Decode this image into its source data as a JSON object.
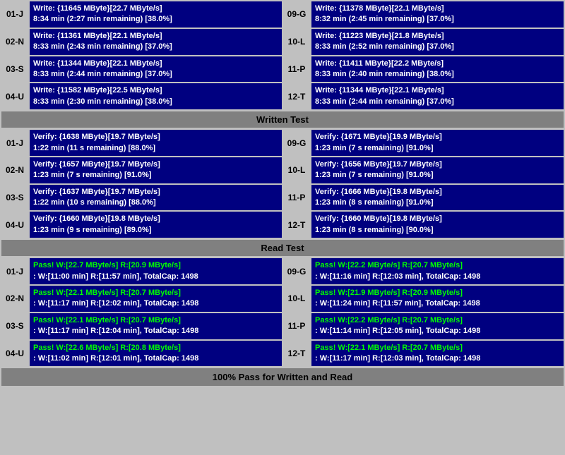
{
  "sections": {
    "write": {
      "rows": [
        {
          "left": {
            "id": "01-J",
            "line1": "Write: {11645 MByte}[22.7 MByte/s]",
            "line2": "8:34 min (2:27 min remaining)  [38.0%]"
          },
          "right": {
            "id": "09-G",
            "line1": "Write: {11378 MByte}[22.1 MByte/s]",
            "line2": "8:32 min (2:45 min remaining)  [37.0%]"
          }
        },
        {
          "left": {
            "id": "02-N",
            "line1": "Write: {11361 MByte}[22.1 MByte/s]",
            "line2": "8:33 min (2:43 min remaining)  [37.0%]"
          },
          "right": {
            "id": "10-L",
            "line1": "Write: {11223 MByte}[21.8 MByte/s]",
            "line2": "8:33 min (2:52 min remaining)  [37.0%]"
          }
        },
        {
          "left": {
            "id": "03-S",
            "line1": "Write: {11344 MByte}[22.1 MByte/s]",
            "line2": "8:33 min (2:44 min remaining)  [37.0%]"
          },
          "right": {
            "id": "11-P",
            "line1": "Write: {11411 MByte}[22.2 MByte/s]",
            "line2": "8:33 min (2:40 min remaining)  [38.0%]"
          }
        },
        {
          "left": {
            "id": "04-U",
            "line1": "Write: {11582 MByte}[22.5 MByte/s]",
            "line2": "8:33 min (2:30 min remaining)  [38.0%]"
          },
          "right": {
            "id": "12-T",
            "line1": "Write: {11344 MByte}[22.1 MByte/s]",
            "line2": "8:33 min (2:44 min remaining)  [37.0%]"
          }
        }
      ],
      "header": "Written Test"
    },
    "verify": {
      "rows": [
        {
          "left": {
            "id": "01-J",
            "line1": "Verify: {1638 MByte}[19.7 MByte/s]",
            "line2": "1:22 min (11 s remaining)   [88.0%]"
          },
          "right": {
            "id": "09-G",
            "line1": "Verify: {1671 MByte}[19.9 MByte/s]",
            "line2": "1:23 min (7 s remaining)   [91.0%]"
          }
        },
        {
          "left": {
            "id": "02-N",
            "line1": "Verify: {1657 MByte}[19.7 MByte/s]",
            "line2": "1:23 min (7 s remaining)   [91.0%]"
          },
          "right": {
            "id": "10-L",
            "line1": "Verify: {1656 MByte}[19.7 MByte/s]",
            "line2": "1:23 min (7 s remaining)   [91.0%]"
          }
        },
        {
          "left": {
            "id": "03-S",
            "line1": "Verify: {1637 MByte}[19.7 MByte/s]",
            "line2": "1:22 min (10 s remaining)   [88.0%]"
          },
          "right": {
            "id": "11-P",
            "line1": "Verify: {1666 MByte}[19.8 MByte/s]",
            "line2": "1:23 min (8 s remaining)   [91.0%]"
          }
        },
        {
          "left": {
            "id": "04-U",
            "line1": "Verify: {1660 MByte}[19.8 MByte/s]",
            "line2": "1:23 min (9 s remaining)   [89.0%]"
          },
          "right": {
            "id": "12-T",
            "line1": "Verify: {1660 MByte}[19.8 MByte/s]",
            "line2": "1:23 min (8 s remaining)   [90.0%]"
          }
        }
      ],
      "header": "Read Test"
    },
    "pass": {
      "rows": [
        {
          "left": {
            "id": "01-J",
            "line1": "Pass! W:[22.7 MByte/s] R:[20.9 MByte/s]",
            "line2": "W:[11:00 min] R:[11:57 min], TotalCap: 1498"
          },
          "right": {
            "id": "09-G",
            "line1": "Pass! W:[22.2 MByte/s] R:[20.7 MByte/s]",
            "line2": "W:[11:16 min] R:[12:03 min], TotalCap: 1498"
          }
        },
        {
          "left": {
            "id": "02-N",
            "line1": "Pass! W:[22.1 MByte/s] R:[20.7 MByte/s]",
            "line2": "W:[11:17 min] R:[12:02 min], TotalCap: 1498"
          },
          "right": {
            "id": "10-L",
            "line1": "Pass! W:[21.9 MByte/s] R:[20.9 MByte/s]",
            "line2": "W:[11:24 min] R:[11:57 min], TotalCap: 1498"
          }
        },
        {
          "left": {
            "id": "03-S",
            "line1": "Pass! W:[22.1 MByte/s] R:[20.7 MByte/s]",
            "line2": "W:[11:17 min] R:[12:04 min], TotalCap: 1498"
          },
          "right": {
            "id": "11-P",
            "line1": "Pass! W:[22.2 MByte/s] R:[20.7 MByte/s]",
            "line2": "W:[11:14 min] R:[12:05 min], TotalCap: 1498"
          }
        },
        {
          "left": {
            "id": "04-U",
            "line1": "Pass! W:[22.6 MByte/s] R:[20.8 MByte/s]",
            "line2": "W:[11:02 min] R:[12:01 min], TotalCap: 1498"
          },
          "right": {
            "id": "12-T",
            "line1": "Pass! W:[22.1 MByte/s] R:[20.7 MByte/s]",
            "line2": "W:[11:17 min] R:[12:03 min], TotalCap: 1498"
          }
        }
      ],
      "header": "Read Test"
    },
    "footer": "100% Pass for Written and Read"
  }
}
